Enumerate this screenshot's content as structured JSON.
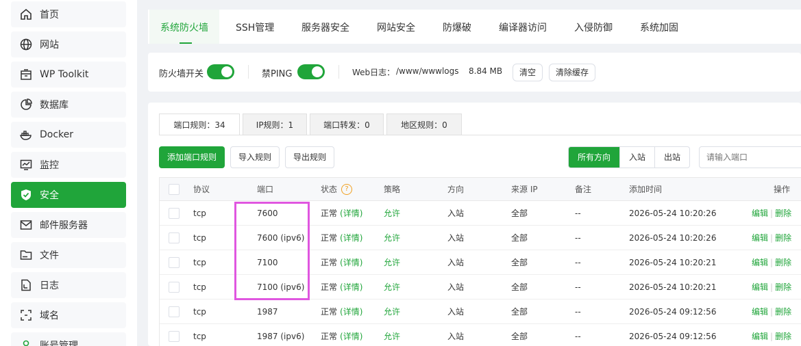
{
  "sidebar": {
    "items": [
      {
        "label": "首页",
        "icon": "home-icon",
        "active": false
      },
      {
        "label": "网站",
        "icon": "globe-icon",
        "active": false
      },
      {
        "label": "WP Toolkit",
        "icon": "toolkit-icon",
        "active": false
      },
      {
        "label": "数据库",
        "icon": "database-icon",
        "active": false
      },
      {
        "label": "Docker",
        "icon": "docker-icon",
        "active": false
      },
      {
        "label": "监控",
        "icon": "monitor-icon",
        "active": false
      },
      {
        "label": "安全",
        "icon": "shield-icon",
        "active": true
      },
      {
        "label": "邮件服务器",
        "icon": "mail-icon",
        "active": false
      },
      {
        "label": "文件",
        "icon": "folder-icon",
        "active": false
      },
      {
        "label": "日志",
        "icon": "log-icon",
        "active": false
      },
      {
        "label": "域名",
        "icon": "domain-icon",
        "active": false
      },
      {
        "label": "账号管理",
        "icon": "user-icon",
        "active": false
      }
    ]
  },
  "topnav": {
    "tabs": [
      "系统防火墙",
      "SSH管理",
      "服务器安全",
      "网站安全",
      "防爆破",
      "编译器访问",
      "入侵防御",
      "系统加固"
    ]
  },
  "toolbar": {
    "firewall_label": "防火墙开关",
    "ping_label": "禁PING",
    "weblog_label": "Web日志：",
    "weblog_path": "/www/wwwlogs",
    "weblog_size": "8.84 MB",
    "clear_label": "清空",
    "clear_cache_label": "清除缓存"
  },
  "rule_tabs": [
    "端口规则：34",
    "IP规则：1",
    "端口转发：0",
    "地区规则：0"
  ],
  "actions": {
    "add": "添加端口规则",
    "import": "导入规则",
    "export": "导出规则",
    "directions": [
      "所有方向",
      "入站",
      "出站"
    ],
    "search_placeholder": "请输入端口"
  },
  "table": {
    "headers": {
      "protocol": "协议",
      "port": "端口",
      "status": "状态",
      "policy": "策略",
      "direction": "方向",
      "source": "来源 IP",
      "note": "备注",
      "time": "添加时间",
      "ops": "操作"
    },
    "help_glyph": "?",
    "rows": [
      {
        "protocol": "tcp",
        "port": "7600",
        "status": "正常",
        "detail": "(详情)",
        "policy": "允许",
        "direction": "入站",
        "source": "全部",
        "note": "--",
        "time": "2026-05-24 10:20:26",
        "edit": "编辑",
        "del": "删除"
      },
      {
        "protocol": "tcp",
        "port": "7600 (ipv6)",
        "status": "正常",
        "detail": "(详情)",
        "policy": "允许",
        "direction": "入站",
        "source": "全部",
        "note": "--",
        "time": "2026-05-24 10:20:26",
        "edit": "编辑",
        "del": "删除"
      },
      {
        "protocol": "tcp",
        "port": "7100",
        "status": "正常",
        "detail": "(详情)",
        "policy": "允许",
        "direction": "入站",
        "source": "全部",
        "note": "--",
        "time": "2026-05-24 10:20:21",
        "edit": "编辑",
        "del": "删除"
      },
      {
        "protocol": "tcp",
        "port": "7100 (ipv6)",
        "status": "正常",
        "detail": "(详情)",
        "policy": "允许",
        "direction": "入站",
        "source": "全部",
        "note": "--",
        "time": "2026-05-24 10:20:21",
        "edit": "编辑",
        "del": "删除"
      },
      {
        "protocol": "tcp",
        "port": "1987",
        "status": "正常",
        "detail": "(详情)",
        "policy": "允许",
        "direction": "入站",
        "source": "全部",
        "note": "--",
        "time": "2026-05-24 09:12:56",
        "edit": "编辑",
        "del": "删除"
      },
      {
        "protocol": "tcp",
        "port": "1987 (ipv6)",
        "status": "正常",
        "detail": "(详情)",
        "policy": "允许",
        "direction": "入站",
        "source": "全部",
        "note": "--",
        "time": "2026-05-24 09:12:56",
        "edit": "编辑",
        "del": "删除"
      }
    ]
  },
  "colors": {
    "accent": "#20a53a",
    "highlight": "#e056e0"
  }
}
